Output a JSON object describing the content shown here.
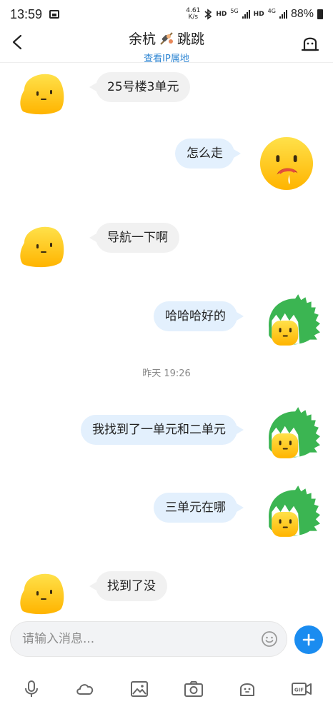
{
  "status_bar": {
    "time": "13:59",
    "net_speed_value": "4.61",
    "net_speed_unit": "K/s",
    "hd1": "HD",
    "sig1_label": "5G",
    "hd2": "HD",
    "sig2_label": "4G",
    "battery": "88%"
  },
  "header": {
    "name_part1": "余杭",
    "name_part2": "跳跳",
    "subtitle": "查看IP属地"
  },
  "messages": [
    {
      "side": "left",
      "text": "25号楼3单元",
      "avatar": "blob-yellow"
    },
    {
      "side": "right",
      "text": "怎么走",
      "avatar": "drooling-face"
    },
    {
      "side": "left",
      "text": "导航一下啊",
      "avatar": "blob-yellow"
    },
    {
      "side": "right",
      "text": "哈哈哈好的",
      "avatar": "dinosaur-costume"
    },
    {
      "side": "right",
      "text": "我找到了一单元和二单元",
      "avatar": "dinosaur-costume"
    },
    {
      "side": "right",
      "text": "三单元在哪",
      "avatar": "dinosaur-costume"
    },
    {
      "side": "left",
      "text": "找到了没",
      "avatar": "blob-yellow"
    }
  ],
  "timestamp": "昨天 19:26",
  "input": {
    "placeholder": "请输入消息..."
  },
  "toolbar": [
    "microphone-icon",
    "cloud-icon",
    "image-icon",
    "camera-icon",
    "sticker-icon",
    "gif-icon"
  ],
  "colors": {
    "accent": "#1a8cf0",
    "link": "#2d85d3",
    "bubble_left": "#f1f1f1",
    "bubble_right": "#e3f0fd",
    "avatar_yellow": "#ffc526",
    "dino_green": "#3bb552"
  }
}
